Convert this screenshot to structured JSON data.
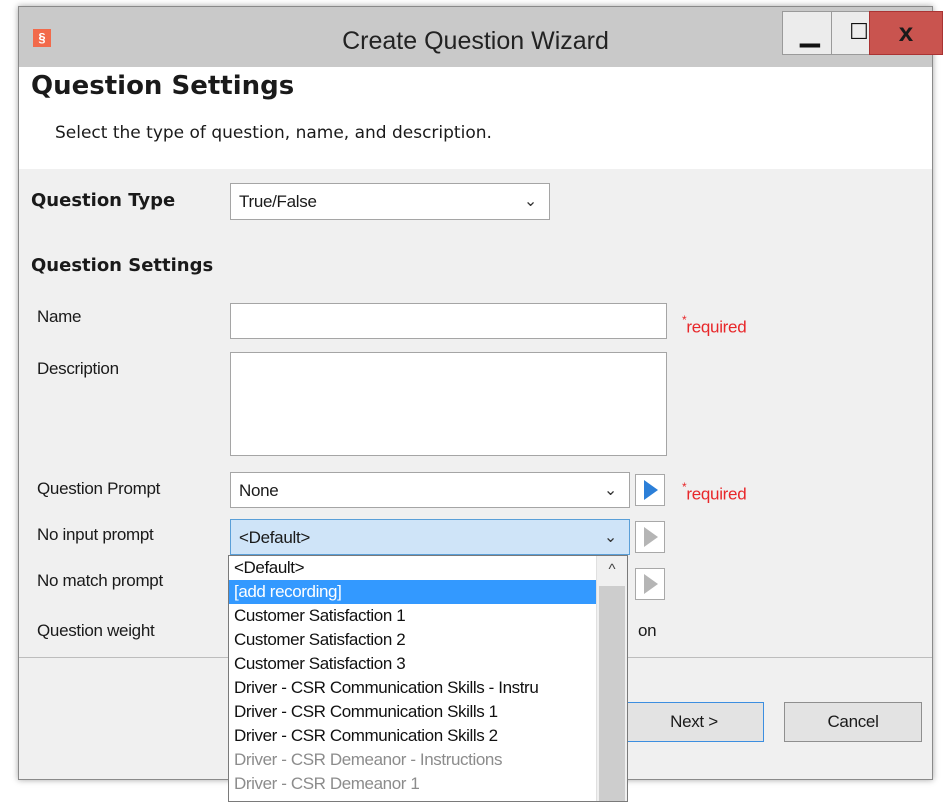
{
  "window": {
    "title": "Create Question Wizard",
    "app_icon": "§",
    "minimize": "▁",
    "maximize": "☐",
    "close": "x"
  },
  "header": {
    "title": "Question Settings",
    "subtitle": "Select the type of question, name, and description."
  },
  "question_type": {
    "label": "Question Type",
    "value": "True/False"
  },
  "settings": {
    "heading": "Question Settings",
    "name": {
      "label": "Name",
      "value": "",
      "required": "required"
    },
    "description": {
      "label": "Description",
      "value": ""
    },
    "question_prompt": {
      "label": "Question Prompt",
      "value": "None",
      "required": "required"
    },
    "no_input_prompt": {
      "label": "No input prompt",
      "value": "<Default>"
    },
    "no_match_prompt": {
      "label": "No match prompt"
    },
    "question_weight": {
      "label": "Question weight",
      "trailing_text": "on"
    }
  },
  "dropdown": {
    "items": [
      "<Default>",
      "[add recording]",
      "Customer Satisfaction 1",
      "Customer Satisfaction 2",
      "Customer Satisfaction 3",
      "Driver - CSR Communication Skills - Instru",
      "Driver - CSR Communication Skills 1",
      "Driver - CSR Communication Skills 2",
      "Driver - CSR Demeanor - Instructions",
      "Driver - CSR Demeanor 1"
    ],
    "selected_index": 1,
    "scroll_up": "^"
  },
  "buttons": {
    "next": "Next >",
    "cancel": "Cancel"
  },
  "colors": {
    "accent": "#3399ff",
    "required": "#e8272a",
    "close": "#c9544f",
    "play": "#2c7fd8"
  }
}
